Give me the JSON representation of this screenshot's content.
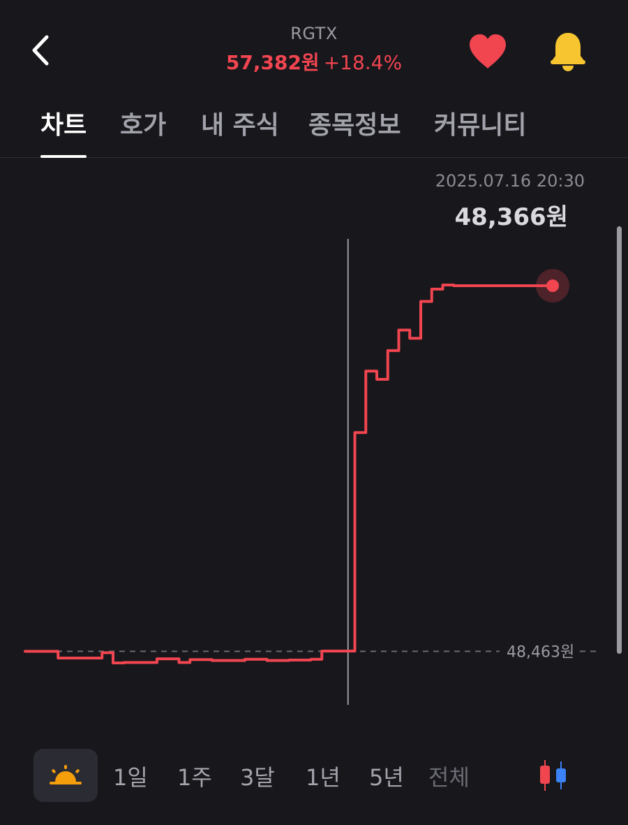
{
  "header": {
    "ticker": "RGTX",
    "price": "57,382원",
    "change": "+18.4%",
    "accent_color": "#f14550",
    "icons": {
      "back": "chevron-left-icon",
      "favorite": "heart-icon",
      "alert": "bell-icon"
    }
  },
  "tabs": [
    {
      "label": "차트",
      "active": true
    },
    {
      "label": "호가",
      "active": false
    },
    {
      "label": "내 주식",
      "active": false
    },
    {
      "label": "종목정보",
      "active": false
    },
    {
      "label": "커뮤니티",
      "active": false
    }
  ],
  "tooltip": {
    "datetime": "2025.07.16 20:30",
    "price": "48,366원"
  },
  "reference": {
    "label": "48,463원"
  },
  "chart_data": {
    "type": "line",
    "x": [
      0,
      1,
      2,
      3,
      4,
      5,
      6,
      7,
      8,
      9,
      10,
      11,
      12,
      13,
      14,
      15,
      16,
      17,
      18,
      19,
      20,
      21,
      22,
      23,
      24,
      25,
      26,
      27,
      28,
      29,
      30,
      31,
      32,
      33,
      34,
      35,
      36,
      37,
      38,
      39,
      40,
      41,
      42,
      43,
      44,
      45,
      46,
      47,
      48
    ],
    "values": [
      48463,
      48463,
      48463,
      48300,
      48300,
      48300,
      48300,
      48430,
      48180,
      48190,
      48190,
      48190,
      48280,
      48280,
      48190,
      48260,
      48260,
      48240,
      48240,
      48240,
      48270,
      48270,
      48240,
      48240,
      48250,
      48250,
      48270,
      48470,
      48470,
      48470,
      53800,
      55300,
      55100,
      55800,
      56300,
      56100,
      57000,
      57300,
      57400,
      57382,
      57382,
      57382,
      57382,
      57382,
      57382,
      57382,
      57382,
      57382,
      57382
    ],
    "reference_line": 48463,
    "line_color": "#f14550",
    "cursor_index": 29
  },
  "periods": {
    "sun_icon": "sunrise-icon",
    "items": [
      {
        "label": "1일",
        "dim": false
      },
      {
        "label": "1주",
        "dim": false
      },
      {
        "label": "3달",
        "dim": false
      },
      {
        "label": "1년",
        "dim": false
      },
      {
        "label": "5년",
        "dim": false
      },
      {
        "label": "전체",
        "dim": true
      }
    ],
    "chart_type_icon": "candlestick-icon"
  }
}
